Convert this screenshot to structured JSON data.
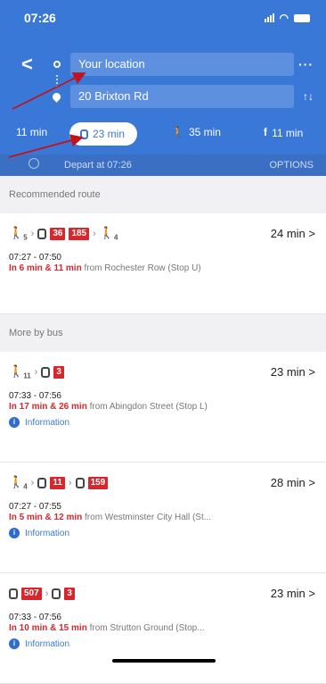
{
  "status": {
    "time": "07:26"
  },
  "route": {
    "origin": "Your location",
    "destination": "20 Brixton Rd"
  },
  "modes": [
    {
      "icon": "car-icon",
      "label": "11 min"
    },
    {
      "icon": "bus-icon",
      "label": "23 min",
      "selected": true
    },
    {
      "icon": "walk-icon",
      "label": "35 min"
    },
    {
      "icon": "bike-icon",
      "label": "11 min"
    }
  ],
  "depart": {
    "label": "Depart at 07:26",
    "options": "OPTIONS"
  },
  "recommended_label": "Recommended route",
  "more_label": "More by bus",
  "routes": [
    {
      "walk1": "5",
      "bus1": "36",
      "bus2": "185",
      "walk2": "4",
      "duration": "24 min >",
      "times": "07:27 - 07:50",
      "next_red": "In 6 min & 11 min",
      "next_rest": " from Rochester Row (Stop U)"
    },
    {
      "walk1": "11",
      "bus1": "3",
      "duration": "23 min >",
      "times": "07:33 - 07:56",
      "next_red": "In 17 min & 26 min",
      "next_rest": " from Abingdon Street (Stop L)",
      "info": "Information"
    },
    {
      "walk1": "4",
      "bus1": "11",
      "bus2": "159",
      "duration": "28 min >",
      "times": "07:27 - 07:55",
      "next_red": "In 5 min & 12 min",
      "next_rest": " from Westminster City Hall (St...",
      "info": "Information"
    },
    {
      "bus1": "507",
      "bus2": "3",
      "duration": "23 min >",
      "times": "07:33 - 07:56",
      "next_red": "In 10 min & 15 min",
      "next_rest": " from Strutton Ground (Stop...",
      "info": "Information"
    }
  ],
  "colors": {
    "header": "#3a78d8",
    "badge": "#d8262c",
    "annotation": "#c0131b"
  }
}
